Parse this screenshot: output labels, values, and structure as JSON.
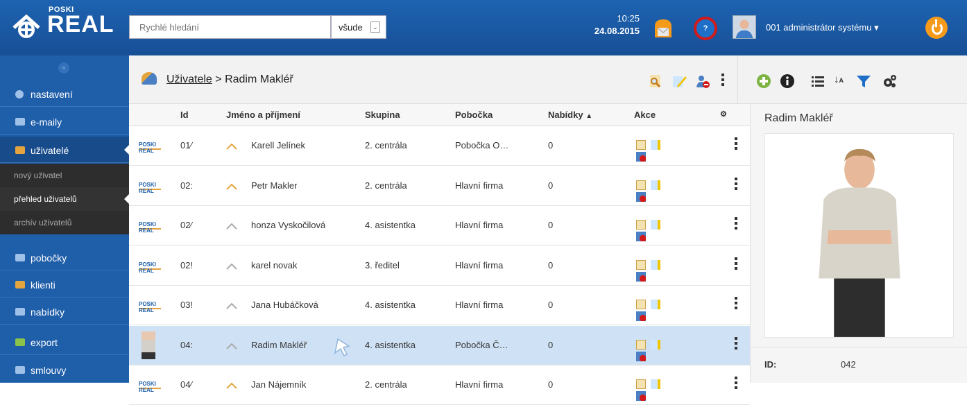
{
  "brand": {
    "small": "POSKI",
    "big": "REAL"
  },
  "search": {
    "placeholder": "Rychlé hledání",
    "scope_value": "všude"
  },
  "clock": {
    "time": "10:25",
    "date": "24.08.2015"
  },
  "user": {
    "name": "001 administrátor systému"
  },
  "help": {
    "label": "?"
  },
  "sidebar": {
    "collapse_label": "«",
    "items": [
      {
        "label": "nastavení",
        "icon": "gear-icon"
      },
      {
        "label": "e-maily",
        "icon": "envelope-icon"
      },
      {
        "label": "uživatelé",
        "icon": "users-icon"
      },
      {
        "label": "pobočky",
        "icon": "branch-icon"
      },
      {
        "label": "klienti",
        "icon": "clients-icon"
      },
      {
        "label": "nabídky",
        "icon": "offers-icon"
      },
      {
        "label": "export",
        "icon": "export-icon"
      },
      {
        "label": "smlouvy",
        "icon": "contracts-icon"
      }
    ],
    "subitems": [
      {
        "label": "nový uživatel"
      },
      {
        "label": "přehled uživatelů"
      },
      {
        "label": "archív uživatelů"
      }
    ]
  },
  "breadcrumb": {
    "parent": "Uživatele",
    "sep": ">",
    "current": "Radim Makléř"
  },
  "table": {
    "columns": {
      "id": "Id",
      "name": "Jméno a příjmení",
      "group": "Skupina",
      "branch": "Pobočka",
      "offers": "Nabídky",
      "sort_indicator": "▲",
      "actions": "Akce"
    },
    "rows": [
      {
        "id": "01⁄",
        "name": "Karell Jelínek",
        "group": "2. centrála",
        "branch": "Pobočka O…",
        "offers": "0",
        "logo": "POSKI REAL"
      },
      {
        "id": "02:",
        "name": "Petr Makler",
        "group": "2. centrála",
        "branch": "Hlavní firma",
        "offers": "0",
        "logo": "POSKI REAL"
      },
      {
        "id": "02⁄",
        "name": "honza Vyskočilová",
        "group": "4. asistentka",
        "branch": "Hlavní firma",
        "offers": "0",
        "logo": "POSKI REAL"
      },
      {
        "id": "02!",
        "name": "karel novak",
        "group": "3. ředitel",
        "branch": "Hlavní firma",
        "offers": "0",
        "logo": "POSKI REAL"
      },
      {
        "id": "03!",
        "name": "Jana Hubáčková",
        "group": "4. asistentka",
        "branch": "Hlavní firma",
        "offers": "0",
        "logo": "POSKI REAL"
      },
      {
        "id": "04:",
        "name": "Radim Makléř",
        "group": "4. asistentka",
        "branch": "Pobočka Č…",
        "offers": "0",
        "logo": ""
      },
      {
        "id": "04⁄",
        "name": "Jan Nájemník",
        "group": "2. centrála",
        "branch": "Hlavní firma",
        "offers": "0",
        "logo": "POSKI REAL"
      }
    ]
  },
  "detail": {
    "title": "Radim Makléř",
    "id_label": "ID:",
    "id_value": "042"
  },
  "colors": {
    "primary": "#1d63b1",
    "sidebar": "#1f5ea9",
    "selected_row": "#cfe2f5",
    "accent": "#f59a1a"
  }
}
